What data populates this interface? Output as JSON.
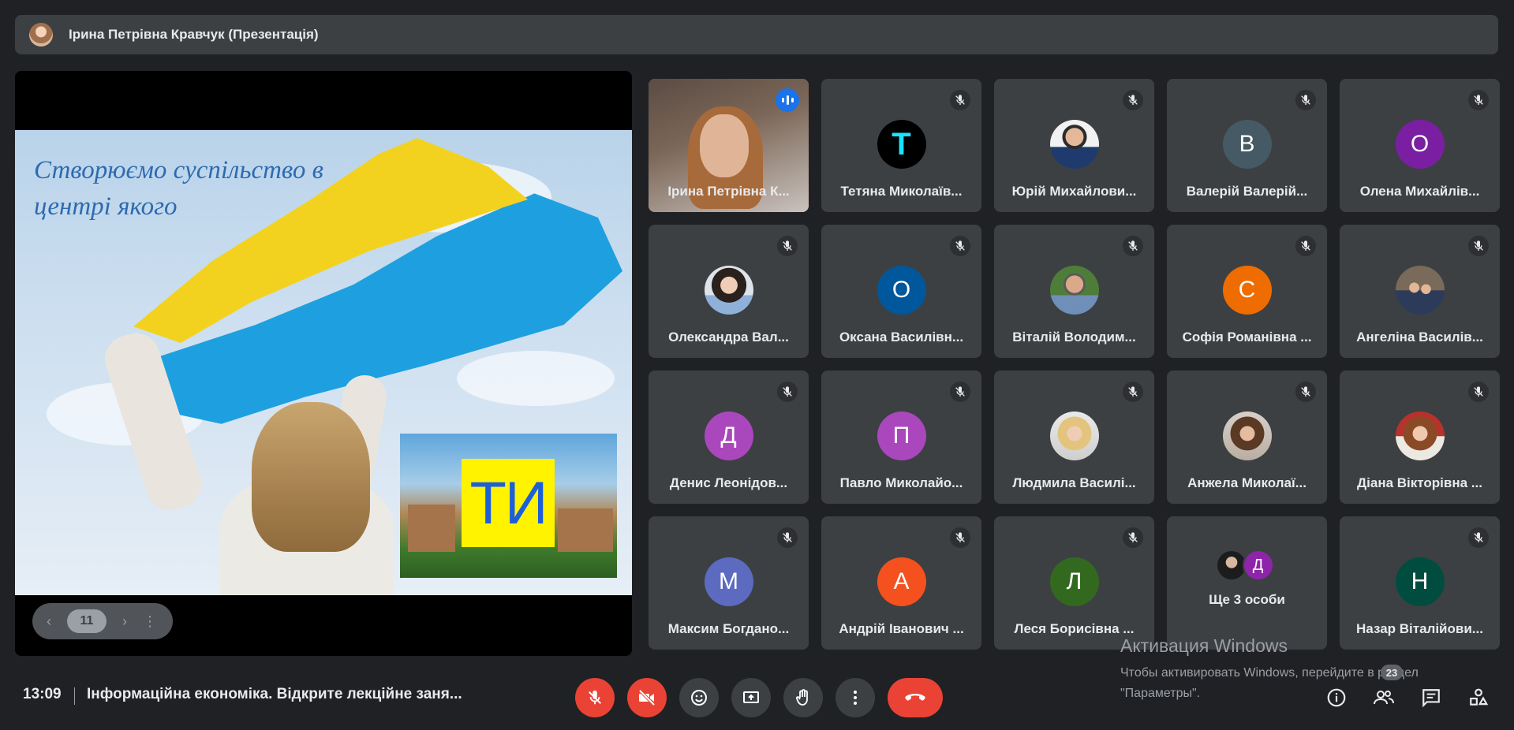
{
  "presenter_bar": {
    "title": "Ірина Петрівна Кравчук (Презентація)"
  },
  "slide": {
    "text": "Створюємо суспільство в центрі якого",
    "inset_text": "ТИ",
    "page_number": "11"
  },
  "participants": [
    {
      "name": "Ірина Петрівна К...",
      "initial": "",
      "kind": "video",
      "speaking": true
    },
    {
      "name": "Тетяна Миколаїв...",
      "initial": "T",
      "kind": "avatar",
      "color": "#000000",
      "fg": "#19e3ff"
    },
    {
      "name": "Юрій Михайлови...",
      "initial": "",
      "kind": "photo-man"
    },
    {
      "name": "Валерій Валерій...",
      "initial": "В",
      "kind": "avatar",
      "color": "#455a64"
    },
    {
      "name": "Олена Михайлів...",
      "initial": "О",
      "kind": "avatar",
      "color": "#7b1fa2"
    },
    {
      "name": "Олександра Вал...",
      "initial": "",
      "kind": "photo-woman-dark"
    },
    {
      "name": "Оксана Василівн...",
      "initial": "О",
      "kind": "avatar",
      "color": "#01579b"
    },
    {
      "name": "Віталій Володим...",
      "initial": "",
      "kind": "photo-man-outdoor"
    },
    {
      "name": "Софія Романівна ...",
      "initial": "С",
      "kind": "avatar",
      "color": "#ef6c00"
    },
    {
      "name": "Ангеліна Василів...",
      "initial": "",
      "kind": "photo-group"
    },
    {
      "name": "Денис Леонідов...",
      "initial": "Д",
      "kind": "avatar",
      "color": "#ab47bc"
    },
    {
      "name": "Павло Миколайо...",
      "initial": "П",
      "kind": "avatar",
      "color": "#ab47bc"
    },
    {
      "name": "Людмила Василі...",
      "initial": "",
      "kind": "photo-woman-blonde"
    },
    {
      "name": "Анжела Миколаї...",
      "initial": "",
      "kind": "photo-woman-brown"
    },
    {
      "name": "Діана Вікторівна ...",
      "initial": "",
      "kind": "photo-woman-red"
    },
    {
      "name": "Максим Богдано...",
      "initial": "М",
      "kind": "avatar",
      "color": "#5c6bc0"
    },
    {
      "name": "Андрій Іванович ...",
      "initial": "А",
      "kind": "avatar",
      "color": "#f4511e"
    },
    {
      "name": "Леся Борисівна ...",
      "initial": "Л",
      "kind": "avatar",
      "color": "#33691e"
    },
    {
      "name": "Ще 3 особи",
      "initial": "Д",
      "kind": "more"
    },
    {
      "name": "Назар Віталійови...",
      "initial": "Н",
      "kind": "avatar",
      "color": "#004d40"
    }
  ],
  "bottom_bar": {
    "time": "13:09",
    "meeting_title": "Інформаційна економіка. Відкрите лекційне заня...",
    "participant_count": "23"
  },
  "watermark": {
    "title": "Активация Windows",
    "line1": "Чтобы активировать Windows, перейдите в раздел",
    "line2": "\"Параметры\"."
  },
  "icons": {
    "mic_off": "mic-off-icon",
    "cam_off": "videocam-off-icon",
    "emoji": "emoji-icon",
    "present": "present-screen-icon",
    "hand": "raise-hand-icon",
    "more": "more-vert-icon",
    "end": "call-end-icon",
    "info": "info-icon",
    "people": "people-icon",
    "chat": "chat-icon",
    "activities": "activities-icon"
  },
  "colors": {
    "background": "#202124",
    "surface": "#3c4043",
    "danger": "#ea4335",
    "accent": "#8ab4f8"
  }
}
